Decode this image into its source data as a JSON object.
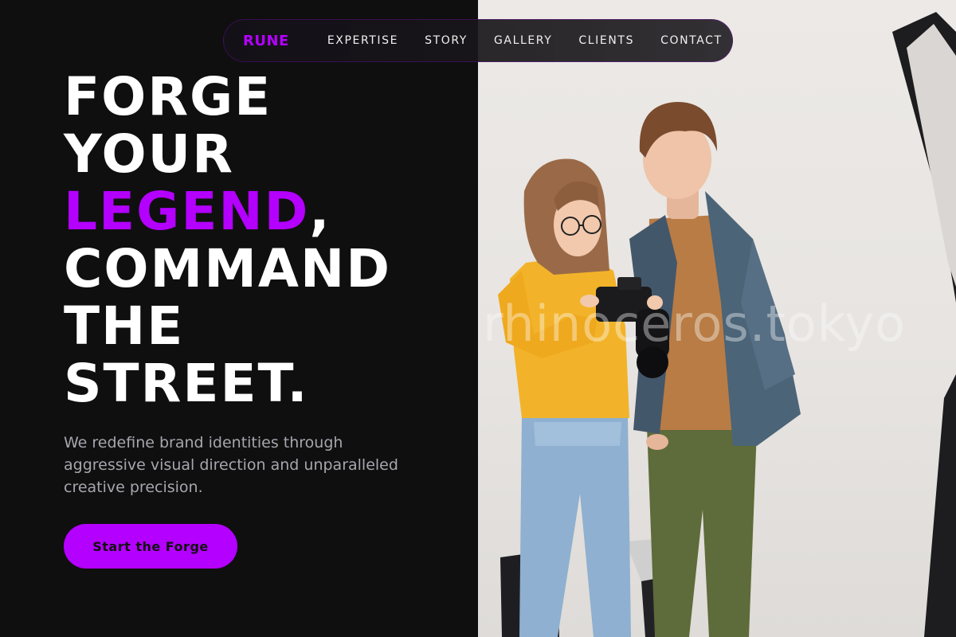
{
  "nav": {
    "brand": "RUNE",
    "links": [
      "EXPERTISE",
      "STORY",
      "GALLERY",
      "CLIENTS",
      "CONTACT"
    ]
  },
  "hero": {
    "headline": {
      "line1": "FORGE",
      "line2": "YOUR",
      "line3_accent": "LEGEND",
      "line3_rest": ",",
      "line4": "COMMAND",
      "line5": "THE",
      "line6": "STREET."
    },
    "subtitle": "We redefine brand identities through aggressive visual direction and unparalleled creative precision.",
    "cta_label": "Start the Forge"
  },
  "photo": {
    "watermark": "rhinoceros.tokyo",
    "subject": "Two photographers reviewing a camera in a white studio"
  },
  "colors": {
    "accent": "#b400ff",
    "background": "#0f0f10",
    "text": "#ffffff",
    "muted": "#a6a6ad"
  }
}
